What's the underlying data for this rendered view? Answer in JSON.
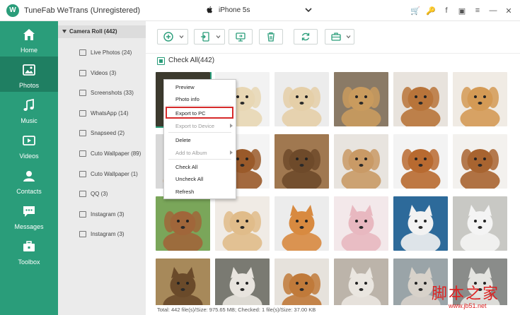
{
  "app": {
    "logo_letter": "W",
    "title": "TuneFab WeTrans (Unregistered)",
    "device": "iPhone 5s"
  },
  "top_icons": [
    {
      "icon": "cart-icon",
      "glyph": "🛒",
      "color": "#e8902b"
    },
    {
      "icon": "key-icon",
      "glyph": "🔑",
      "color": "#e8902b"
    },
    {
      "icon": "facebook-icon",
      "glyph": "f",
      "color": "#555555"
    },
    {
      "icon": "feedback-icon",
      "glyph": "▣",
      "color": "#555555"
    },
    {
      "icon": "menu-icon",
      "glyph": "≡",
      "color": "#555555"
    },
    {
      "icon": "minimize-icon",
      "glyph": "—",
      "color": "#555555"
    },
    {
      "icon": "close-icon",
      "glyph": "✕",
      "color": "#555555"
    }
  ],
  "sidebar": {
    "items": [
      {
        "label": "Home",
        "icon": "home-icon"
      },
      {
        "label": "Photos",
        "icon": "photos-icon"
      },
      {
        "label": "Music",
        "icon": "music-icon"
      },
      {
        "label": "Videos",
        "icon": "videos-icon"
      },
      {
        "label": "Contacts",
        "icon": "contacts-icon"
      },
      {
        "label": "Messages",
        "icon": "messages-icon"
      },
      {
        "label": "Toolbox",
        "icon": "toolbox-icon"
      }
    ],
    "active": "Photos"
  },
  "albums": {
    "header": "Camera Roll (442)",
    "items": [
      {
        "label": "Live Photos (24)"
      },
      {
        "label": "Videos (3)"
      },
      {
        "label": "Screenshots (33)"
      },
      {
        "label": "WhatsApp (14)"
      },
      {
        "label": "Snapseed (2)"
      },
      {
        "label": "Cuto Wallpaper (89)"
      },
      {
        "label": "Cuto Wallpaper (1)"
      },
      {
        "label": "QQ (3)"
      },
      {
        "label": "Instagram (3)"
      },
      {
        "label": "Instagram (3)"
      }
    ]
  },
  "toolbar": {
    "buttons": [
      {
        "icon": "add-icon",
        "dropdown": true
      },
      {
        "icon": "export-device-icon",
        "dropdown": true
      },
      {
        "icon": "export-pc-icon",
        "dropdown": false
      },
      {
        "icon": "delete-icon",
        "dropdown": false
      },
      {
        "icon": "refresh-icon",
        "dropdown": false
      },
      {
        "icon": "toolbox-icon",
        "dropdown": true
      }
    ]
  },
  "main": {
    "check_all": "Check All(442)",
    "status": "Total: 442 file(s)/Size: 975.65 MB; Checked: 1 file(s)/Size: 37.00 KB"
  },
  "context_menu": {
    "items": [
      {
        "label": "Preview",
        "disabled": false,
        "submenu": false
      },
      {
        "label": "Photo info",
        "disabled": false,
        "submenu": false
      },
      {
        "label": "Export to PC",
        "disabled": false,
        "submenu": false,
        "highlighted": true
      },
      {
        "label": "Export to Device",
        "disabled": true,
        "submenu": true
      },
      {
        "label": "Delete",
        "disabled": false,
        "submenu": false
      },
      {
        "label": "Add to Album",
        "disabled": true,
        "submenu": true
      },
      {
        "label": "Check All",
        "disabled": false,
        "submenu": false
      },
      {
        "label": "Uncheck All",
        "disabled": false,
        "submenu": false
      },
      {
        "label": "Refresh",
        "disabled": false,
        "submenu": false
      }
    ]
  },
  "photos": [
    {
      "desc": "dog-photo",
      "bg": "#3c3a2e",
      "fg": "#6a5a3a"
    },
    {
      "desc": "dog-photo",
      "bg": "#f2f2f2",
      "fg": "#e8d7b4"
    },
    {
      "desc": "dog-photo",
      "bg": "#ececec",
      "fg": "#e5cfa8"
    },
    {
      "desc": "dog-photo",
      "bg": "#8a7a66",
      "fg": "#c99b5e"
    },
    {
      "desc": "dog-photo",
      "bg": "#e8e3dd",
      "fg": "#b8743a"
    },
    {
      "desc": "dog-photo",
      "bg": "#f0ebe4",
      "fg": "#d49a55"
    },
    {
      "desc": "dog-photo",
      "bg": "#d8d8d8",
      "fg": "#c8a070"
    },
    {
      "desc": "dog-photo",
      "bg": "#f4f4f4",
      "fg": "#9a5a2a"
    },
    {
      "desc": "dog-photo",
      "bg": "#a07850",
      "fg": "#6e4a2a"
    },
    {
      "desc": "dog-photo",
      "bg": "#e8e4df",
      "fg": "#c99a66"
    },
    {
      "desc": "dog-photo",
      "bg": "#f3f3f3",
      "fg": "#b86a30"
    },
    {
      "desc": "dog-photo",
      "bg": "#f3f1ee",
      "fg": "#a86430"
    },
    {
      "desc": "dog-photo",
      "bg": "#7aa65a",
      "fg": "#a0663a"
    },
    {
      "desc": "dog-photo",
      "bg": "#f0ebe5",
      "fg": "#e0bc8a"
    },
    {
      "desc": "cat-photo",
      "bg": "#ececec",
      "fg": "#d88a40"
    },
    {
      "desc": "cat-photo",
      "bg": "#f3e8ea",
      "fg": "#e8b8c0"
    },
    {
      "desc": "cat-photo",
      "bg": "#2d6a9a",
      "fg": "#f2f2f2"
    },
    {
      "desc": "cat-photo",
      "bg": "#c8c8c4",
      "fg": "#f4f4f4"
    },
    {
      "desc": "cat-photo",
      "bg": "#a7895a",
      "fg": "#6a4a2a"
    },
    {
      "desc": "cat-photo",
      "bg": "#7a7a72",
      "fg": "#e8e4de"
    },
    {
      "desc": "dog-photo",
      "bg": "#e6e2dc",
      "fg": "#c07a3a"
    },
    {
      "desc": "cat-photo",
      "bg": "#bcb4aa",
      "fg": "#eae6e0"
    },
    {
      "desc": "cat-photo",
      "bg": "#9aa4a8",
      "fg": "#d8d2ca"
    },
    {
      "desc": "cat-photo",
      "bg": "#8a8c8a",
      "fg": "#e4e4e0"
    }
  ],
  "watermark": {
    "chinese": "脚本之家",
    "url": "www.jb51.net"
  },
  "colors": {
    "accent": "#2a9d7a",
    "accent_dark": "#1f7f62",
    "highlight": "#d62a2a"
  }
}
